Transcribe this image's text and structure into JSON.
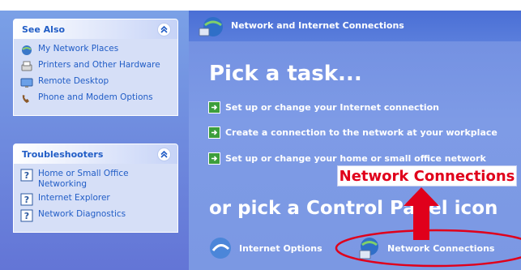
{
  "see_also": {
    "title": "See Also",
    "items": [
      {
        "label": "My Network Places",
        "icon": "network-places-icon"
      },
      {
        "label": "Printers and Other Hardware",
        "icon": "printer-icon"
      },
      {
        "label": "Remote Desktop",
        "icon": "remote-desktop-icon"
      },
      {
        "label": "Phone and Modem Options",
        "icon": "phone-icon"
      }
    ]
  },
  "troubleshooters": {
    "title": "Troubleshooters",
    "items": [
      {
        "label": "Home or Small Office Networking",
        "icon": "help-icon"
      },
      {
        "label": "Internet Explorer",
        "icon": "help-icon"
      },
      {
        "label": "Network Diagnostics",
        "icon": "help-icon"
      }
    ]
  },
  "header": {
    "title": "Network and Internet Connections",
    "icon": "network-globe-icon"
  },
  "pick_task": {
    "title": "Pick a task...",
    "tasks": [
      {
        "label": "Set up or change your Internet connection"
      },
      {
        "label": "Create a connection to the network at your workplace"
      },
      {
        "label": "Set up or change your home or small office network"
      }
    ]
  },
  "control_panel": {
    "title": "or pick a Control Panel icon",
    "icons": [
      {
        "label": "Internet Options",
        "icon": "internet-options-icon"
      },
      {
        "label": "Network Connections",
        "icon": "network-connections-icon"
      }
    ]
  },
  "annotation": {
    "callout_label": "Network Connections",
    "color": "#e0001b"
  }
}
